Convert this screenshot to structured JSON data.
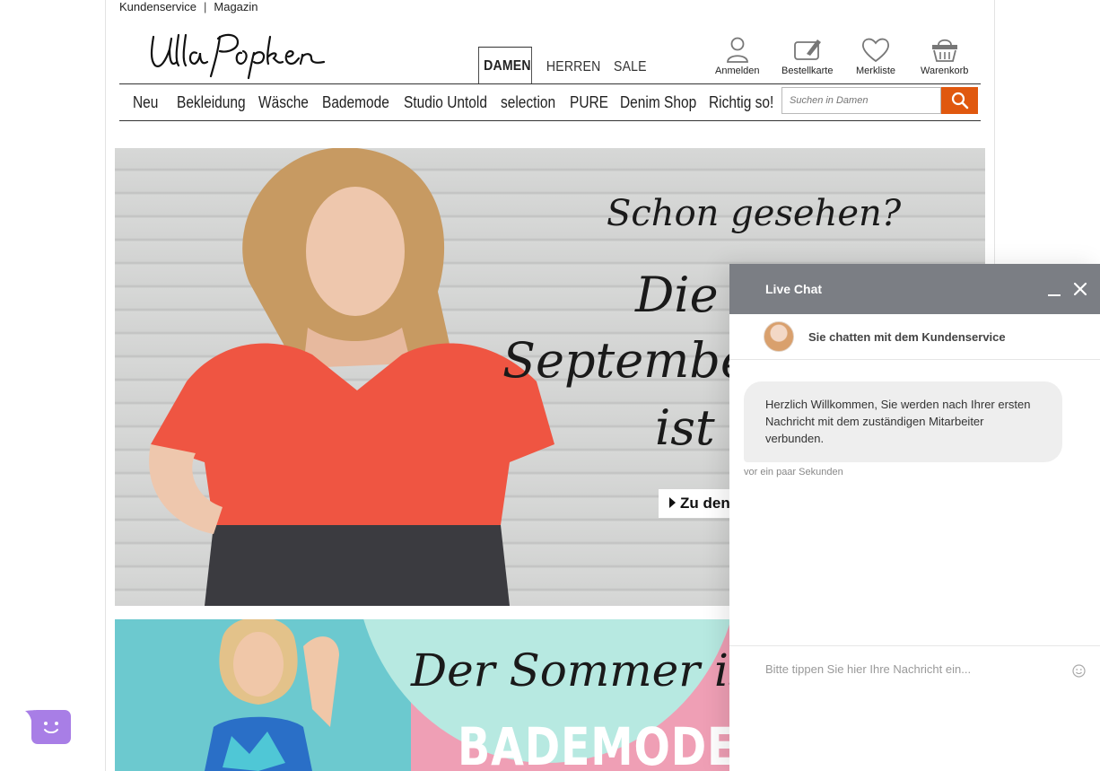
{
  "header": {
    "service_links": [
      "Kundenservice",
      "Magazin"
    ],
    "separator": "|",
    "logo_text": "Ulla Popken",
    "gender_tabs": [
      {
        "label": "DAMEN",
        "active": true
      },
      {
        "label": "HERREN",
        "active": false
      },
      {
        "label": "SALE",
        "active": false
      }
    ],
    "utilities": [
      {
        "label": "Anmelden",
        "icon": "user-icon"
      },
      {
        "label": "Bestellkarte",
        "icon": "order-card-icon"
      },
      {
        "label": "Merkliste",
        "icon": "heart-icon"
      },
      {
        "label": "Warenkorb",
        "icon": "basket-icon"
      }
    ],
    "nav": [
      "Neu",
      "Bekleidung",
      "Wäsche",
      "Bademode",
      "Studio Untold",
      "selection",
      "PURE",
      "Denim Shop",
      "Richtig so!"
    ],
    "search": {
      "placeholder": "Suchen in Damen"
    }
  },
  "hero": {
    "lines": [
      "Schon gesehen?",
      "Die",
      "September",
      "ist"
    ],
    "cta": "Zu den"
  },
  "banner2": {
    "script": "Der Sommer is",
    "title": "BADEMODE A"
  },
  "chat": {
    "title": "Live Chat",
    "agent_text": "Sie chatten mit dem Kundenservice",
    "message": "Herzlich Willkommen, Sie werden nach Ihrer ersten Nachricht mit dem zuständigen Mitarbeiter verbunden.",
    "timestamp": "vor ein paar Sekunden",
    "input_placeholder": "Bitte tippen Sie hier Ihre Nachricht ein..."
  },
  "colors": {
    "search_button": "#e0580f",
    "chat_header": "#7b7e84",
    "launcher": "#a87ee6"
  }
}
